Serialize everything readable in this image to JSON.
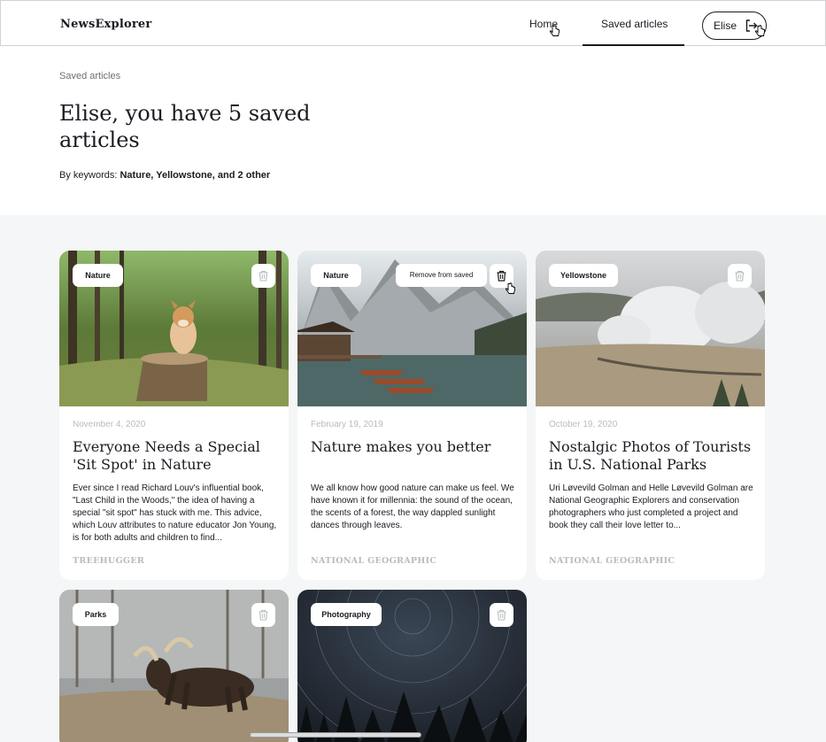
{
  "header": {
    "logo": "NewsExplorer",
    "nav": {
      "home": "Home",
      "saved": "Saved articles"
    },
    "user_name": "Elise",
    "logout_icon": "logout-icon"
  },
  "intro": {
    "breadcrumb": "Saved articles",
    "title": "Elise, you have 5 saved articles",
    "keywords_label": "By keywords: ",
    "keywords_value": "Nature, Yellowstone, and 2 other"
  },
  "cards": [
    {
      "keyword": "Nature",
      "date": "November 4, 2020",
      "title": "Everyone Needs a Special 'Sit Spot' in Nature",
      "text": "Ever since I read Richard Louv's influential book, \"Last Child in the Woods,\" the idea of having a special \"sit spot\" has stuck with me. This advice, which Louv attributes to nature educator Jon Young, is for both adults and children to find...",
      "source": "TREEHUGGER"
    },
    {
      "keyword": "Nature",
      "tooltip": "Remove from saved",
      "date": "February 19, 2019",
      "title": "Nature makes you better",
      "text": "We all know how good nature can make us feel. We have known it for millennia: the sound of the ocean, the scents of a forest, the way dappled sunlight dances through leaves.",
      "source": "NATIONAL GEOGRAPHIC"
    },
    {
      "keyword": "Yellowstone",
      "date": "October 19, 2020",
      "title": "Nostalgic Photos of Tourists in U.S. National Parks",
      "text": "Uri Løvevild Golman and Helle Løvevild Golman are National Geographic Explorers and conservation photographers who just completed a project and book they call their love letter to...",
      "source": "NATIONAL GEOGRAPHIC"
    },
    {
      "keyword": "Parks"
    },
    {
      "keyword": "Photography"
    }
  ],
  "colors": {
    "text": "#1a1b22",
    "muted": "#b6bcbf",
    "background": "#f5f6f7"
  }
}
